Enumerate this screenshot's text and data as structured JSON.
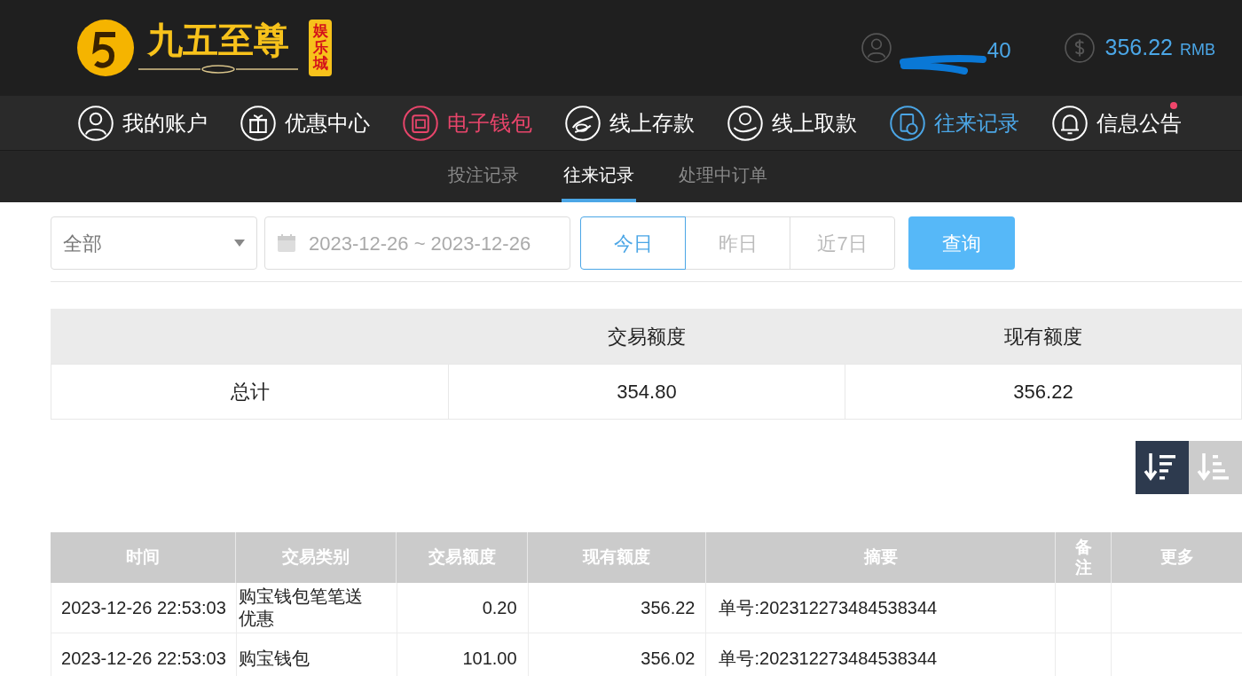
{
  "logo": {
    "name": "九五至尊",
    "badge": "娱乐城"
  },
  "account": {
    "username": "40",
    "balance": "356.22",
    "currency": "RMB"
  },
  "nav": [
    {
      "label": "我的账户",
      "color": "#ffffff",
      "notification": false
    },
    {
      "label": "优惠中心",
      "color": "#ffffff",
      "notification": false
    },
    {
      "label": "电子钱包",
      "color": "#e8456b",
      "notification": false
    },
    {
      "label": "线上存款",
      "color": "#ffffff",
      "notification": false
    },
    {
      "label": "线上取款",
      "color": "#ffffff",
      "notification": false
    },
    {
      "label": "往来记录",
      "color": "#4ba6e6",
      "notification": false
    },
    {
      "label": "信息公告",
      "color": "#ffffff",
      "notification": true
    }
  ],
  "subtabs": [
    {
      "label": "投注记录",
      "selected": false
    },
    {
      "label": "往来记录",
      "selected": true
    },
    {
      "label": "处理中订单",
      "selected": false
    }
  ],
  "filters": {
    "type": "全部",
    "date_range": "2023-12-26 ~ 2023-12-26",
    "quick": [
      {
        "label": "今日",
        "selected": true
      },
      {
        "label": "昨日",
        "selected": false
      },
      {
        "label": "近7日",
        "selected": false
      }
    ],
    "search": "查询"
  },
  "summary": {
    "columns": [
      "交易额度",
      "现有额度"
    ],
    "row": [
      "总计",
      "354.80",
      "356.22"
    ]
  },
  "sort": [
    {
      "kind": "desc",
      "selected": true
    },
    {
      "kind": "asc",
      "selected": false
    }
  ],
  "table": {
    "columns": [
      "时间",
      "交易类别",
      "交易额度",
      "现有额度",
      "摘要",
      "备注",
      "更多"
    ],
    "rows": [
      [
        "2023-12-26 22:53:03",
        "购宝钱包笔笔送优惠",
        "0.20",
        "356.22",
        "单号:202312273484538344",
        "",
        ""
      ],
      [
        "2023-12-26 22:53:03",
        "购宝钱包",
        "101.00",
        "356.02",
        "单号:202312273484538344",
        "",
        ""
      ]
    ]
  }
}
